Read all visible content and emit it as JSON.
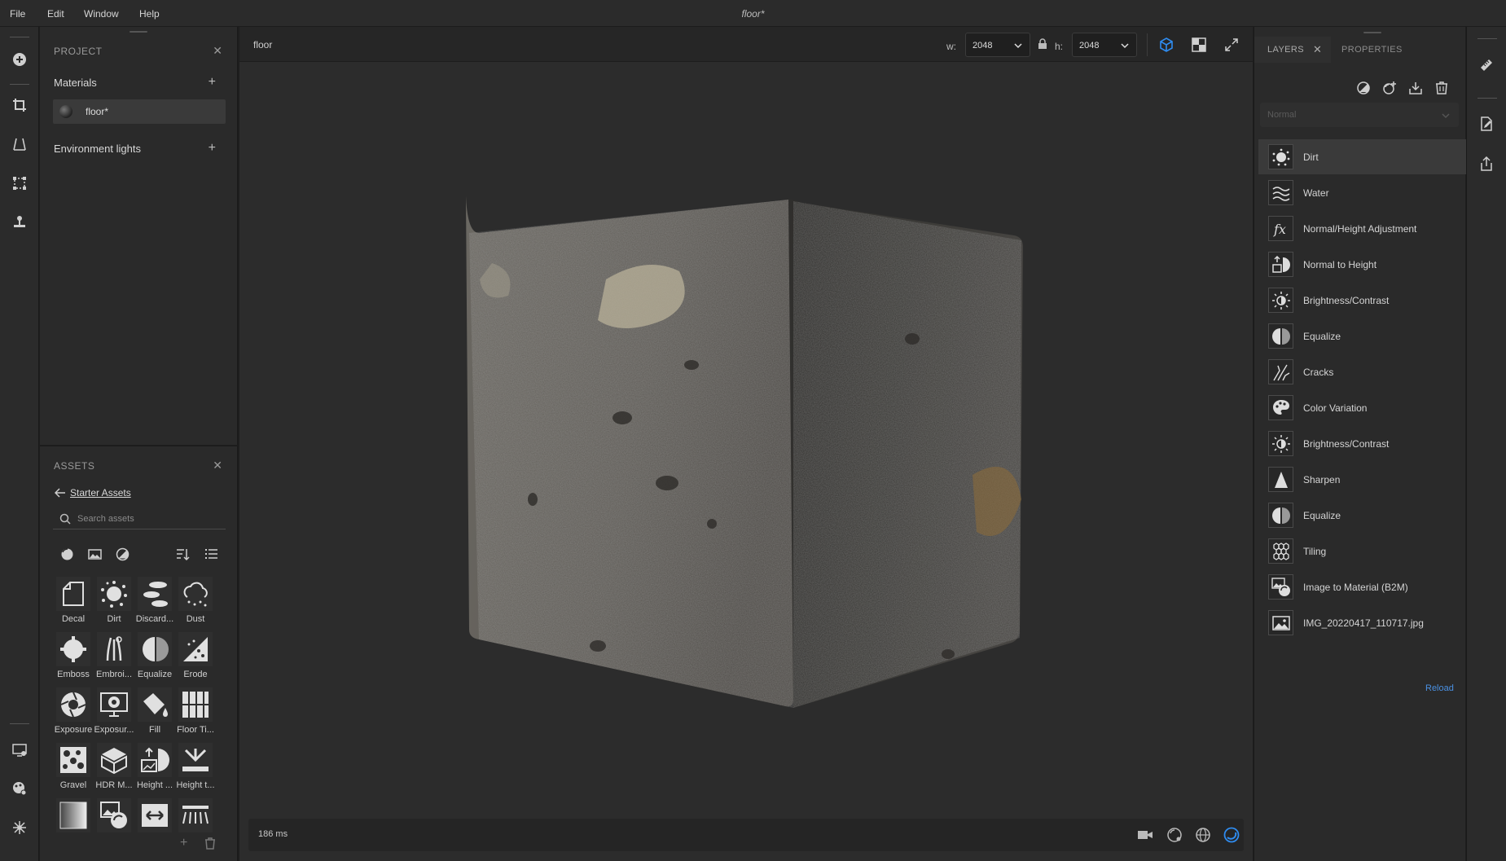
{
  "menubar": {
    "items": [
      "File",
      "Edit",
      "Window",
      "Help"
    ],
    "document_title": "floor*"
  },
  "project": {
    "title": "PROJECT",
    "materials_label": "Materials",
    "material_name": "floor*",
    "env_lights_label": "Environment lights"
  },
  "assets": {
    "title": "ASSETS",
    "back_label": "Starter Assets",
    "search_placeholder": "Search assets",
    "items": [
      {
        "label": "Decal",
        "icon": "decal-icon"
      },
      {
        "label": "Dirt",
        "icon": "dirt-icon"
      },
      {
        "label": "Discard...",
        "icon": "discard-icon"
      },
      {
        "label": "Dust",
        "icon": "dust-icon"
      },
      {
        "label": "Emboss",
        "icon": "emboss-icon"
      },
      {
        "label": "Embroi...",
        "icon": "embroidery-icon"
      },
      {
        "label": "Equalize",
        "icon": "equalize-icon"
      },
      {
        "label": "Erode",
        "icon": "erode-icon"
      },
      {
        "label": "Exposure",
        "icon": "exposure-icon"
      },
      {
        "label": "Exposur...",
        "icon": "exposure-monitor-icon"
      },
      {
        "label": "Fill",
        "icon": "fill-icon"
      },
      {
        "label": "Floor Ti...",
        "icon": "floor-tiles-icon"
      },
      {
        "label": "Gravel",
        "icon": "gravel-icon"
      },
      {
        "label": "HDR M...",
        "icon": "hdr-icon"
      },
      {
        "label": "Height ...",
        "icon": "height-icon"
      },
      {
        "label": "Height t...",
        "icon": "height-to-icon"
      },
      {
        "label": "",
        "icon": "gradient-icon"
      },
      {
        "label": "",
        "icon": "image-to-material-icon"
      },
      {
        "label": "",
        "icon": "offset-icon"
      },
      {
        "label": "",
        "icon": "light-icon"
      }
    ]
  },
  "viewport": {
    "name": "floor",
    "width_label": "w:",
    "width_value": "2048",
    "height_label": "h:",
    "height_value": "2048",
    "render_time": "186 ms"
  },
  "layers": {
    "tab_layers": "LAYERS",
    "tab_properties": "PROPERTIES",
    "blend_mode": "Normal",
    "items": [
      {
        "name": "Dirt",
        "icon": "dirt-icon"
      },
      {
        "name": "Water",
        "icon": "water-icon"
      },
      {
        "name": "Normal/Height Adjustment",
        "icon": "fx-icon"
      },
      {
        "name": "Normal to Height",
        "icon": "normal-to-height-icon"
      },
      {
        "name": "Brightness/Contrast",
        "icon": "brightness-icon"
      },
      {
        "name": "Equalize",
        "icon": "equalize-icon"
      },
      {
        "name": "Cracks",
        "icon": "cracks-icon"
      },
      {
        "name": "Color Variation",
        "icon": "palette-icon"
      },
      {
        "name": "Brightness/Contrast",
        "icon": "brightness-icon"
      },
      {
        "name": "Sharpen",
        "icon": "sharpen-icon"
      },
      {
        "name": "Equalize",
        "icon": "equalize-icon"
      },
      {
        "name": "Tiling",
        "icon": "tiling-icon"
      },
      {
        "name": "Image to Material (B2M)",
        "icon": "image-to-material-icon"
      },
      {
        "name": "IMG_20220417_110717.jpg",
        "icon": "image-icon"
      }
    ],
    "reload_label": "Reload"
  },
  "colors": {
    "accent": "#2f8cf0",
    "panel_bg": "#2a2a2a",
    "viewport_bg": "#2c2c2c"
  }
}
